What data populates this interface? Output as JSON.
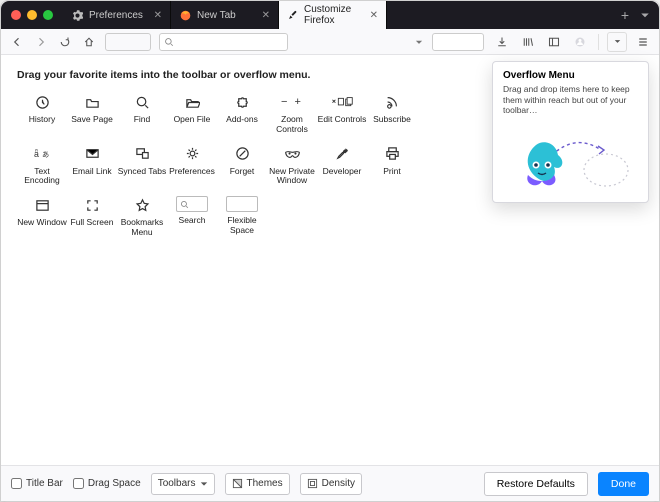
{
  "tabs": [
    {
      "label": "Preferences",
      "icon": "gear"
    },
    {
      "label": "New Tab",
      "icon": "firefox"
    },
    {
      "label": "Customize Firefox",
      "icon": "brush",
      "active": true
    }
  ],
  "instruction": "Drag your favorite items into the toolbar or overflow menu.",
  "items": [
    {
      "id": "history",
      "label": "History",
      "icon": "history"
    },
    {
      "id": "savepage",
      "label": "Save Page",
      "icon": "folder"
    },
    {
      "id": "find",
      "label": "Find",
      "icon": "search"
    },
    {
      "id": "openfile",
      "label": "Open File",
      "icon": "folder-open"
    },
    {
      "id": "addons",
      "label": "Add-ons",
      "icon": "puzzle"
    },
    {
      "id": "zoom",
      "label": "Zoom Controls",
      "icon": "zoom"
    },
    {
      "id": "edit",
      "label": "Edit Controls",
      "icon": "edit"
    },
    {
      "id": "subscribe",
      "label": "Subscribe",
      "icon": "rss"
    },
    {
      "id": "encoding",
      "label": "Text Encoding",
      "icon": "encoding"
    },
    {
      "id": "emaillink",
      "label": "Email Link",
      "icon": "mail"
    },
    {
      "id": "synced",
      "label": "Synced Tabs",
      "icon": "synced"
    },
    {
      "id": "preferences",
      "label": "Preferences",
      "icon": "gear"
    },
    {
      "id": "forget",
      "label": "Forget",
      "icon": "forget"
    },
    {
      "id": "private",
      "label": "New Private Window",
      "icon": "mask"
    },
    {
      "id": "developer",
      "label": "Developer",
      "icon": "wrench"
    },
    {
      "id": "print",
      "label": "Print",
      "icon": "print"
    },
    {
      "id": "newwindow",
      "label": "New Window",
      "icon": "window"
    },
    {
      "id": "fullscreen",
      "label": "Full Screen",
      "icon": "fullscreen"
    },
    {
      "id": "bookmarks",
      "label": "Bookmarks Menu",
      "icon": "star"
    },
    {
      "id": "search",
      "label": "Search",
      "icon": "search-field"
    },
    {
      "id": "flexspace",
      "label": "Flexible Space",
      "icon": "flex"
    }
  ],
  "overflow": {
    "title": "Overflow Menu",
    "desc": "Drag and drop items here to keep them within reach but out of your toolbar…"
  },
  "footer": {
    "titlebar": "Title Bar",
    "dragspace": "Drag Space",
    "toolbars": "Toolbars",
    "themes": "Themes",
    "density": "Density",
    "restore": "Restore Defaults",
    "done": "Done"
  }
}
